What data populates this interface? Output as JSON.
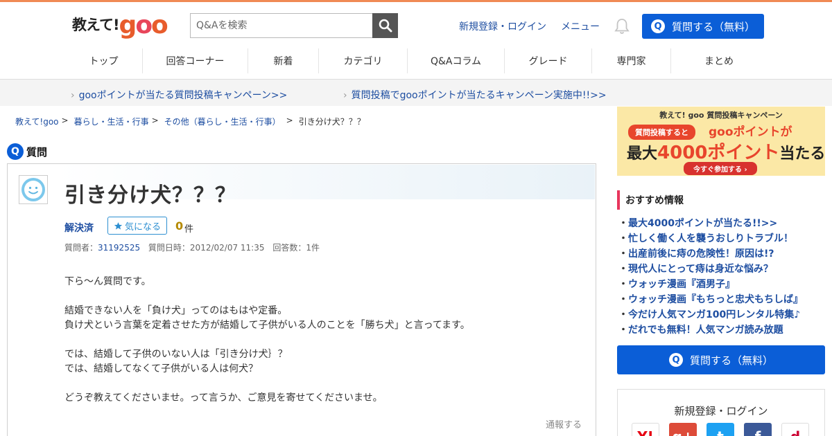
{
  "header": {
    "logo_text": "教えて!",
    "logo_brand": "goo",
    "search_placeholder": "Q&Aを検索",
    "register_login": "新規登録・ログイン",
    "menu": "メニュー",
    "ask_button": "質問する（無料）",
    "q_mark": "Q"
  },
  "nav": [
    {
      "label": "トップ"
    },
    {
      "label": "回答コーナー"
    },
    {
      "label": "新着"
    },
    {
      "label": "カテゴリ"
    },
    {
      "label": "Q&Aコラム"
    },
    {
      "label": "グレード"
    },
    {
      "label": "専門家"
    },
    {
      "label": "まとめ"
    }
  ],
  "campaigns": [
    "gooポイントが当たる質問投稿キャンペーン>>",
    "質問投稿でgooポイントが当たるキャンペーン実施中!!>>"
  ],
  "breadcrumb": [
    "教えて!goo",
    "暮らし・生活・行事",
    "その他（暮らし・生活・行事）",
    "引き分け犬？？？"
  ],
  "breadcrumb_sep": ">",
  "question_label": "質問",
  "question": {
    "title": "引き分け犬？？？",
    "status": "解決済",
    "favorite_label": "気になる",
    "favorite_count": "0",
    "favorite_unit": "件",
    "asker_label": "質問者：",
    "asker_id": "31192525",
    "date_label": "質問日時：2012/02/07 11:35",
    "answers_label": "回答数：1件",
    "body": [
      "下ら～ん質問です。",
      "",
      "結婚できない人を「負け犬」ってのはもはや定番。",
      "負け犬という言葉を定着させた方が結婚して子供がいる人のことを「勝ち犬」と言ってます。",
      "",
      "では、結婚して子供のいない人は「引き分け犬｝？",
      "では、結婚してなくて子供がいる人は何犬？",
      "",
      "どうぞ教えてくださいませ。って言うか、ご意見を寄せてくださいませ。"
    ],
    "report": "通報する"
  },
  "banner": {
    "top": "教えて! goo 質問投稿キャンペーン",
    "pill": "質問投稿すると",
    "right": "gooポイントが",
    "main_prefix": "最大",
    "main_big": "4000ポイント",
    "main_suffix": "当たる!",
    "cta": "今すぐ参加する ›"
  },
  "recommend": {
    "title": "おすすめ情報",
    "items": [
      "最大4000ポイントが当たる!!>>",
      "忙しく働く人を襲うおしりトラブル！",
      "出産前後に痔の危険性！原因は!?",
      "現代人にとって痔は身近な悩み？",
      "ウォッチ漫画『酒男子』",
      "ウォッチ漫画『もちっと忠犬もちしば』",
      "今だけ人気マンガ100円レンタル特集♪",
      "だれでも無料！人気マンガ読み放題"
    ]
  },
  "side_ask_button": "質問する（無料）",
  "login_box": {
    "title": "新規登録・ログイン",
    "services": [
      "Y!",
      "g+",
      "t",
      "f",
      "d"
    ]
  },
  "colors": {
    "accent_blue": "#0b5ed7",
    "link_blue": "#1e4ea1",
    "brand_orange": "#e85c2c",
    "top_bar": "#f08a54"
  }
}
